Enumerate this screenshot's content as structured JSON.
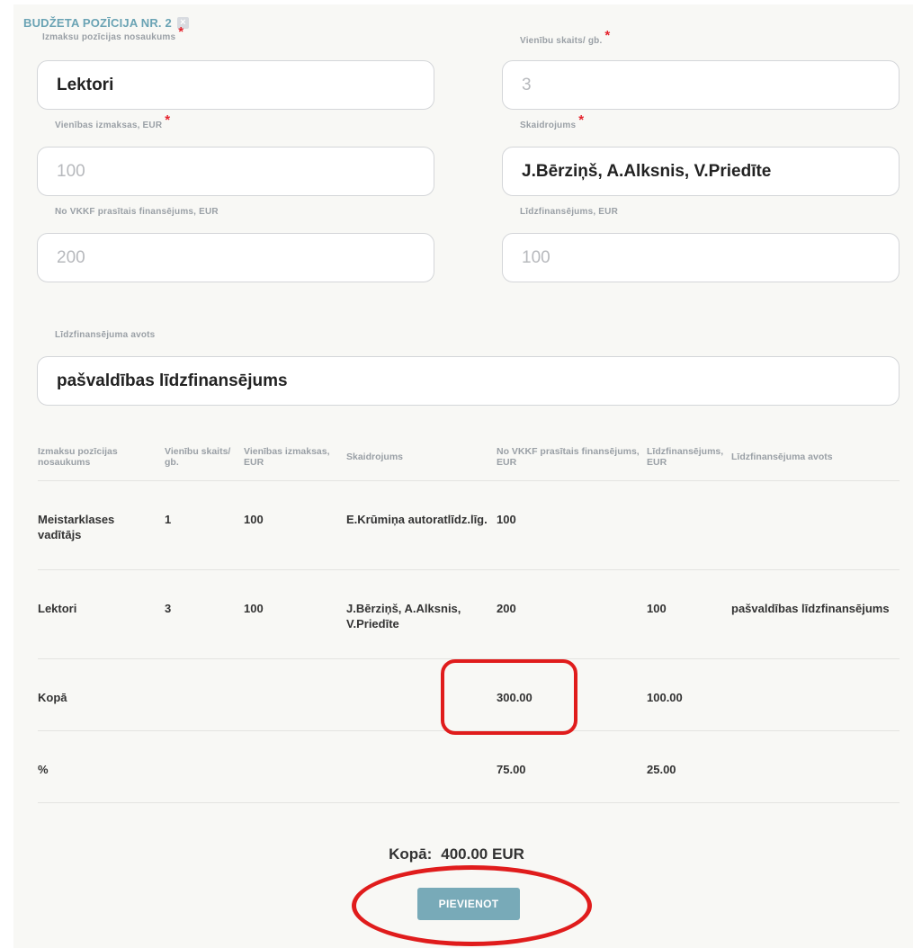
{
  "section": {
    "title": "BUDŽETA POZĪCIJA NR. 2",
    "close_icon": "×"
  },
  "form": {
    "item_name": {
      "label": "Izmaksu pozīcijas nosaukums",
      "value": "Lektori"
    },
    "unit_count": {
      "label": "Vienību skaits/ gb.",
      "placeholder": "3"
    },
    "unit_cost": {
      "label": "Vienības izmaksas, EUR",
      "placeholder": "100"
    },
    "explanation": {
      "label": "Skaidrojums",
      "value": "J.Bērziņš, A.Alksnis, V.Priedīte"
    },
    "vkkf_funding": {
      "label": "No VKKF prasītais finansējums, EUR",
      "placeholder": "200"
    },
    "cofunding": {
      "label": "Līdzfinansējums, EUR",
      "placeholder": "100"
    },
    "cofunding_source": {
      "label": "Līdzfinansējuma avots",
      "value": "pašvaldības līdzfinansējums"
    },
    "required_mark": "*"
  },
  "table": {
    "headers": [
      "Izmaksu pozīcijas nosaukums",
      "Vienību skaits/ gb.",
      "Vienības izmaksas, EUR",
      "Skaidrojums",
      "No VKKF prasītais finansējums, EUR",
      "Līdzfinansējums, EUR",
      "Līdzfinansējuma avots"
    ],
    "rows": [
      [
        "Meistarklases vadītājs",
        "1",
        "100",
        "E.Krūmiņa autoratlīdz.līg.",
        "100",
        "",
        ""
      ],
      [
        "Lektori",
        "3",
        "100",
        "J.Bērziņš, A.Alksnis, V.Priedīte",
        "200",
        "100",
        "pašvaldības līdzfinansējums"
      ],
      [
        "Kopā",
        "",
        "",
        "",
        "300.00",
        "100.00",
        ""
      ],
      [
        "%",
        "",
        "",
        "",
        "75.00",
        "25.00",
        ""
      ]
    ]
  },
  "summary": {
    "label": "Kopā:",
    "value": "400.00 EUR"
  },
  "add_button": {
    "label": "PIEVIENOT"
  },
  "colors": {
    "accent": "#6aa3b4",
    "button": "#78aab8",
    "required": "#e5232d",
    "highlight": "#e01c1c"
  }
}
